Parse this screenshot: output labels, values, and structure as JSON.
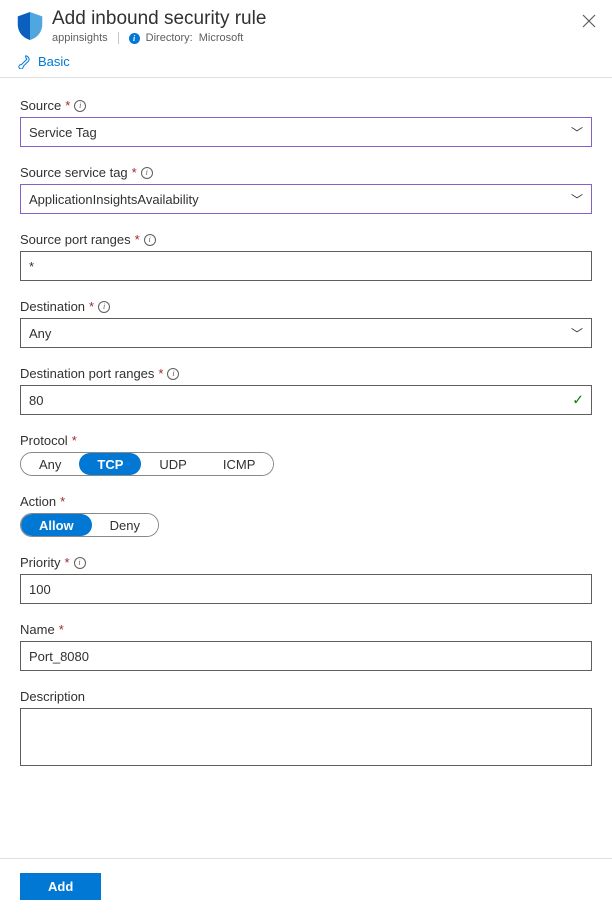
{
  "header": {
    "title": "Add inbound security rule",
    "resource": "appinsights",
    "directory_label": "Directory:",
    "directory_value": "Microsoft",
    "basic_label": "Basic"
  },
  "fields": {
    "source": {
      "label": "Source",
      "value": "Service Tag"
    },
    "source_tag": {
      "label": "Source service tag",
      "value": "ApplicationInsightsAvailability"
    },
    "source_ports": {
      "label": "Source port ranges",
      "value": "*"
    },
    "destination": {
      "label": "Destination",
      "value": "Any"
    },
    "dest_ports": {
      "label": "Destination port ranges",
      "value": "80"
    },
    "protocol": {
      "label": "Protocol",
      "options": [
        "Any",
        "TCP",
        "UDP",
        "ICMP"
      ],
      "selected": "TCP"
    },
    "action": {
      "label": "Action",
      "options": [
        "Allow",
        "Deny"
      ],
      "selected": "Allow"
    },
    "priority": {
      "label": "Priority",
      "value": "100"
    },
    "name": {
      "label": "Name",
      "value": "Port_8080"
    },
    "description": {
      "label": "Description",
      "value": ""
    }
  },
  "footer": {
    "add_label": "Add"
  }
}
